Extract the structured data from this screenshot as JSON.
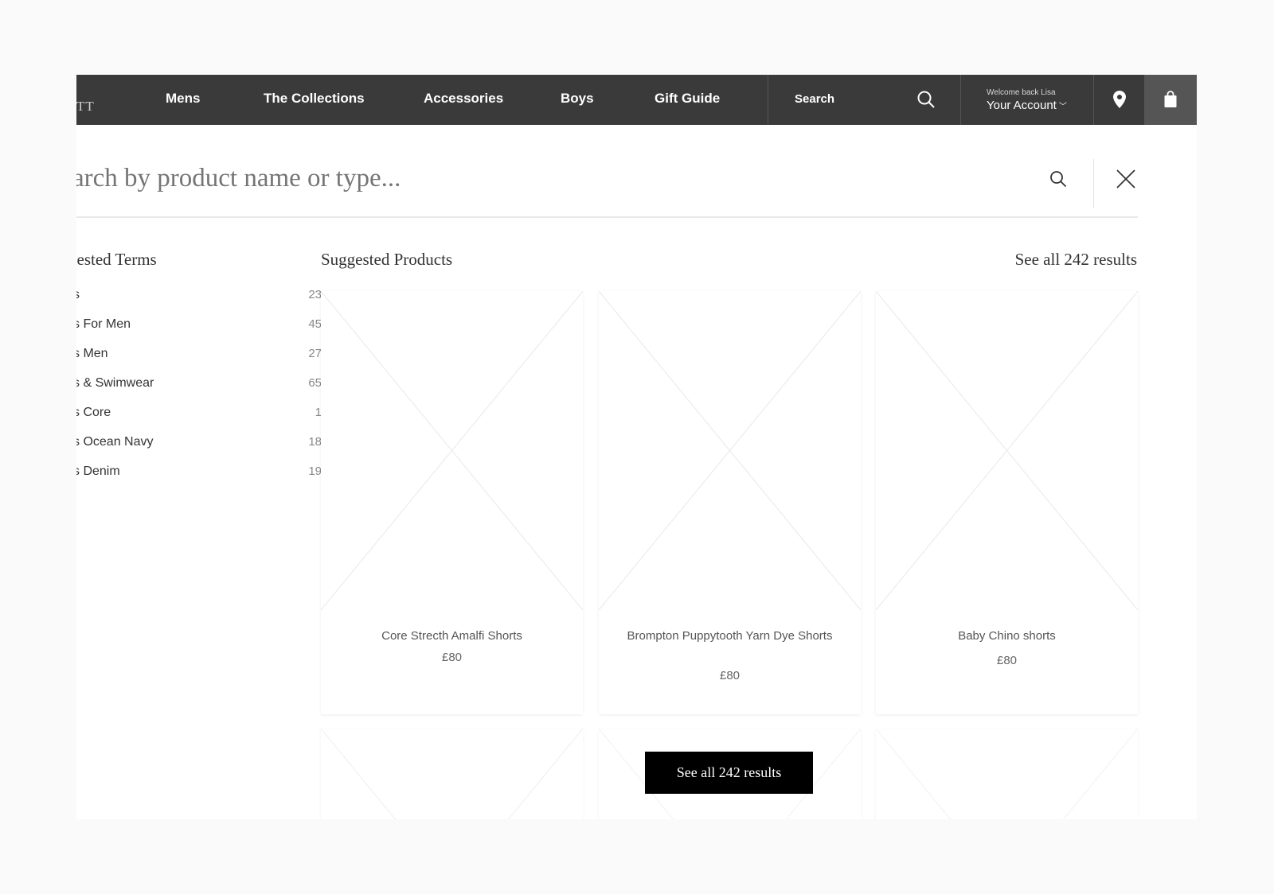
{
  "nav": {
    "brand_fragment": "TT",
    "items": [
      "Mens",
      "The Collections",
      "Accessories",
      "Boys",
      "Gift Guide"
    ],
    "search_label": "Search",
    "account_welcome": "Welcome back Lisa",
    "account_label": "Your Account"
  },
  "search": {
    "placeholder": "arch by product name or type..."
  },
  "suggested_terms": {
    "title": "gested Terms",
    "items": [
      {
        "label": "s",
        "count": "23"
      },
      {
        "label": "s For Men",
        "count": "45"
      },
      {
        "label": "s Men",
        "count": "27"
      },
      {
        "label": "s & Swimwear",
        "count": "65"
      },
      {
        "label": "s Core",
        "count": "1"
      },
      {
        "label": "s Ocean Navy",
        "count": "18"
      },
      {
        "label": "s Denim",
        "count": "19"
      }
    ]
  },
  "products": {
    "title": "Suggested Products",
    "see_all_link": "See all 242 results",
    "see_all_button": "See all 242 results",
    "items": [
      {
        "name": "Core Strecth Amalfi Shorts",
        "price": "£80"
      },
      {
        "name": "Brompton Puppytooth Yarn Dye Shorts",
        "price": "£80"
      },
      {
        "name": "Baby Chino shorts",
        "price": "£80"
      }
    ]
  },
  "colors": {
    "nav_bg": "#3a3a3a",
    "button_bg": "#000000"
  }
}
